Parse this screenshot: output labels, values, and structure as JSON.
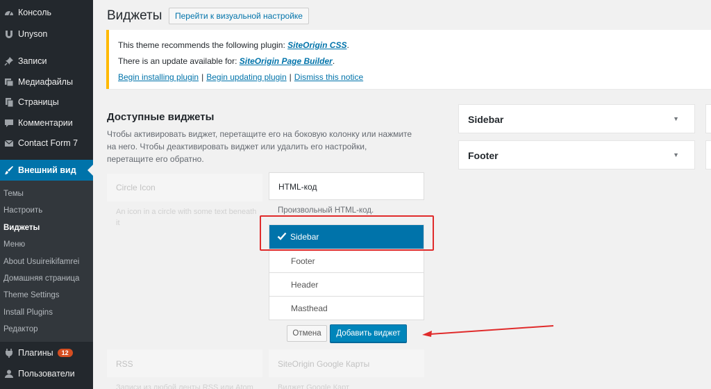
{
  "menu": {
    "items": [
      {
        "label": "Консоль",
        "icon": "dashboard-icon"
      },
      {
        "label": "Unyson",
        "icon": "unyson-icon"
      },
      {
        "label": "Записи",
        "icon": "pin-icon"
      },
      {
        "label": "Медиафайлы",
        "icon": "media-icon"
      },
      {
        "label": "Страницы",
        "icon": "pages-icon"
      },
      {
        "label": "Комментарии",
        "icon": "comments-icon"
      },
      {
        "label": "Contact Form 7",
        "icon": "mail-icon"
      },
      {
        "label": "Внешний вид",
        "icon": "brush-icon"
      }
    ],
    "submenu": [
      "Темы",
      "Настроить",
      "Виджеты",
      "Меню",
      "About Usuireikifamrei",
      "Домашняя страница",
      "Theme Settings",
      "Install Plugins",
      "Редактор"
    ],
    "plugins": {
      "label": "Плагины",
      "badge": "12"
    },
    "users": {
      "label": "Пользователи"
    }
  },
  "header": {
    "title": "Виджеты",
    "action": "Перейти к визуальной настройке"
  },
  "notice": {
    "line1_text": "This theme recommends the following plugin: ",
    "line1_link": "SiteOrigin CSS",
    "line2_text": "There is an update available for: ",
    "line2_link": "SiteOrigin Page Builder",
    "link_install": "Begin installing plugin",
    "link_update": "Begin updating plugin",
    "link_dismiss": "Dismiss this notice",
    "sep": "|",
    "dot": "."
  },
  "available": {
    "title": "Доступные виджеты",
    "description": "Чтобы активировать виджет, перетащите его на боковую колонку или нажмите на него. Чтобы деактивировать виджет или удалить его настройки, перетащите его обратно."
  },
  "ghosts": {
    "circle_title": "Circle Icon",
    "circle_desc": "An icon in a circle with some text beneath it",
    "rss_title": "RSS",
    "rss_desc": "Записи из любой ленты RSS или Atom",
    "gmaps_title": "SiteOrigin Google Карты",
    "gmaps_desc": "Виджет Google Карт"
  },
  "widget": {
    "title": "HTML-код",
    "description": "Произвольный HTML-код.",
    "choices": [
      "Sidebar",
      "Footer",
      "Header",
      "Masthead"
    ],
    "selected": "Sidebar",
    "cancel": "Отмена",
    "add": "Добавить виджет"
  },
  "areas": [
    {
      "title": "Sidebar"
    },
    {
      "title": "Footer"
    }
  ],
  "colors": {
    "accent": "#0073aa",
    "sidebar_bg": "#23282d",
    "notice_border": "#ffb900",
    "annotation_red": "#e02b2b"
  }
}
